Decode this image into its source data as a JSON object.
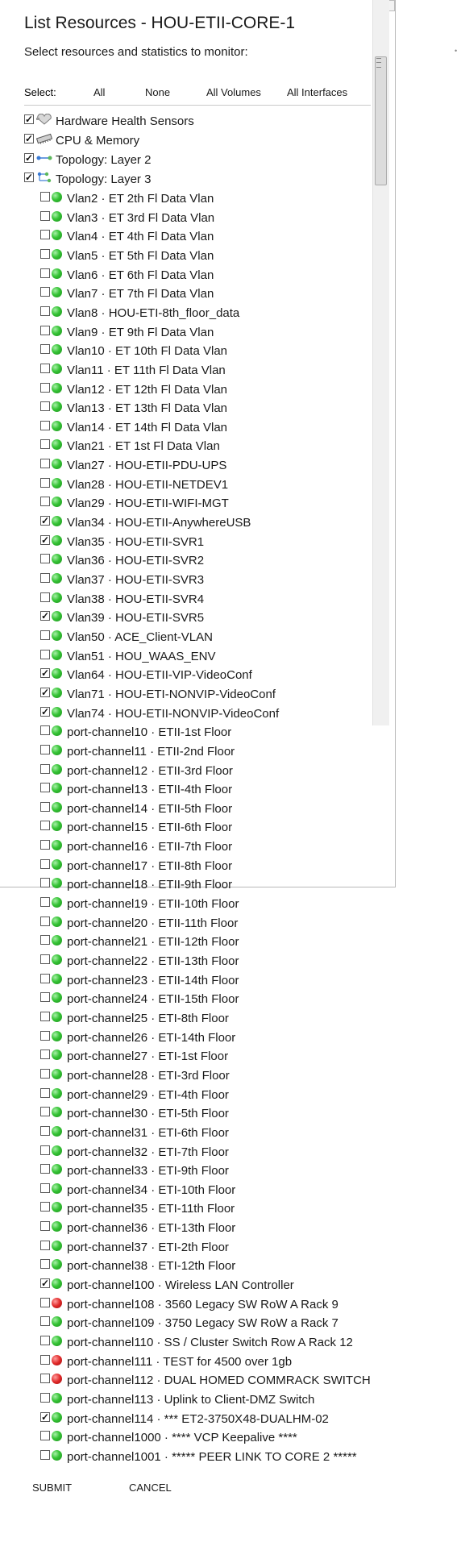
{
  "dialog": {
    "title": "List Resources - HOU-ETII-CORE-1",
    "instructions": "Select resources and statistics to monitor:"
  },
  "select_bar": {
    "label": "Select:",
    "all": "All",
    "none": "None",
    "all_volumes": "All Volumes",
    "all_interfaces": "All Interfaces"
  },
  "categories": [
    {
      "label": "Hardware Health Sensors",
      "checked": true,
      "icon": "heart-sensor-icon"
    },
    {
      "label": "CPU & Memory",
      "checked": true,
      "icon": "memory-chip-icon"
    },
    {
      "label": "Topology: Layer 2",
      "checked": true,
      "icon": "topology-l2-icon"
    },
    {
      "label": "Topology: Layer 3",
      "checked": true,
      "icon": "topology-l3-icon"
    }
  ],
  "interfaces": [
    {
      "label": "Vlan2 · ET 2th Fl Data Vlan",
      "checked": false,
      "status": "up"
    },
    {
      "label": "Vlan3 · ET 3rd Fl Data Vlan",
      "checked": false,
      "status": "up"
    },
    {
      "label": "Vlan4 · ET 4th Fl Data Vlan",
      "checked": false,
      "status": "up"
    },
    {
      "label": "Vlan5 · ET 5th Fl Data Vlan",
      "checked": false,
      "status": "up"
    },
    {
      "label": "Vlan6 · ET 6th Fl Data Vlan",
      "checked": false,
      "status": "up"
    },
    {
      "label": "Vlan7 · ET 7th Fl Data Vlan",
      "checked": false,
      "status": "up"
    },
    {
      "label": "Vlan8 · HOU-ETI-8th_floor_data",
      "checked": false,
      "status": "up"
    },
    {
      "label": "Vlan9 · ET 9th Fl Data Vlan",
      "checked": false,
      "status": "up"
    },
    {
      "label": "Vlan10 · ET 10th Fl Data Vlan",
      "checked": false,
      "status": "up"
    },
    {
      "label": "Vlan11 · ET 11th Fl Data Vlan",
      "checked": false,
      "status": "up"
    },
    {
      "label": "Vlan12 · ET 12th Fl Data Vlan",
      "checked": false,
      "status": "up"
    },
    {
      "label": "Vlan13 · ET 13th Fl Data Vlan",
      "checked": false,
      "status": "up"
    },
    {
      "label": "Vlan14 · ET 14th Fl Data Vlan",
      "checked": false,
      "status": "up"
    },
    {
      "label": "Vlan21 · ET 1st Fl Data Vlan",
      "checked": false,
      "status": "up"
    },
    {
      "label": "Vlan27 · HOU-ETII-PDU-UPS",
      "checked": false,
      "status": "up"
    },
    {
      "label": "Vlan28 · HOU-ETII-NETDEV1",
      "checked": false,
      "status": "up"
    },
    {
      "label": "Vlan29 · HOU-ETII-WIFI-MGT",
      "checked": false,
      "status": "up"
    },
    {
      "label": "Vlan34 · HOU-ETII-AnywhereUSB",
      "checked": true,
      "status": "up"
    },
    {
      "label": "Vlan35 · HOU-ETII-SVR1",
      "checked": true,
      "status": "up"
    },
    {
      "label": "Vlan36 · HOU-ETII-SVR2",
      "checked": false,
      "status": "up"
    },
    {
      "label": "Vlan37 · HOU-ETII-SVR3",
      "checked": false,
      "status": "up"
    },
    {
      "label": "Vlan38 · HOU-ETII-SVR4",
      "checked": false,
      "status": "up"
    },
    {
      "label": "Vlan39 · HOU-ETII-SVR5",
      "checked": true,
      "status": "up"
    },
    {
      "label": "Vlan50 · ACE_Client-VLAN",
      "checked": false,
      "status": "up"
    },
    {
      "label": "Vlan51 · HOU_WAAS_ENV",
      "checked": false,
      "status": "up"
    },
    {
      "label": "Vlan64 · HOU-ETII-VIP-VideoConf",
      "checked": true,
      "status": "up"
    },
    {
      "label": "Vlan71 · HOU-ETI-NONVIP-VideoConf",
      "checked": true,
      "status": "up"
    },
    {
      "label": "Vlan74 · HOU-ETII-NONVIP-VideoConf",
      "checked": true,
      "status": "up"
    },
    {
      "label": "port-channel10 · ETII-1st Floor",
      "checked": false,
      "status": "up"
    },
    {
      "label": "port-channel11 · ETII-2nd Floor",
      "checked": false,
      "status": "up"
    },
    {
      "label": "port-channel12 · ETII-3rd Floor",
      "checked": false,
      "status": "up"
    },
    {
      "label": "port-channel13 · ETII-4th Floor",
      "checked": false,
      "status": "up"
    },
    {
      "label": "port-channel14 · ETII-5th Floor",
      "checked": false,
      "status": "up"
    },
    {
      "label": "port-channel15 · ETII-6th Floor",
      "checked": false,
      "status": "up"
    },
    {
      "label": "port-channel16 · ETII-7th Floor",
      "checked": false,
      "status": "up"
    },
    {
      "label": "port-channel17 · ETII-8th Floor",
      "checked": false,
      "status": "up"
    },
    {
      "label": "port-channel18 · ETII-9th Floor",
      "checked": false,
      "status": "up"
    },
    {
      "label": "port-channel19 · ETII-10th Floor",
      "checked": false,
      "status": "up"
    },
    {
      "label": "port-channel20 · ETII-11th Floor",
      "checked": false,
      "status": "up"
    },
    {
      "label": "port-channel21 · ETII-12th Floor",
      "checked": false,
      "status": "up"
    },
    {
      "label": "port-channel22 · ETII-13th Floor",
      "checked": false,
      "status": "up"
    },
    {
      "label": "port-channel23 · ETII-14th Floor",
      "checked": false,
      "status": "up"
    },
    {
      "label": "port-channel24 · ETII-15th Floor",
      "checked": false,
      "status": "up"
    },
    {
      "label": "port-channel25 · ETI-8th Floor",
      "checked": false,
      "status": "up"
    },
    {
      "label": "port-channel26 · ETI-14th Floor",
      "checked": false,
      "status": "up"
    },
    {
      "label": "port-channel27 · ETI-1st Floor",
      "checked": false,
      "status": "up"
    },
    {
      "label": "port-channel28 · ETI-3rd Floor",
      "checked": false,
      "status": "up"
    },
    {
      "label": "port-channel29 · ETI-4th Floor",
      "checked": false,
      "status": "up"
    },
    {
      "label": "port-channel30 · ETI-5th Floor",
      "checked": false,
      "status": "up"
    },
    {
      "label": "port-channel31 · ETI-6th Floor",
      "checked": false,
      "status": "up"
    },
    {
      "label": "port-channel32 · ETI-7th Floor",
      "checked": false,
      "status": "up"
    },
    {
      "label": "port-channel33 · ETI-9th Floor",
      "checked": false,
      "status": "up"
    },
    {
      "label": "port-channel34 · ETI-10th Floor",
      "checked": false,
      "status": "up"
    },
    {
      "label": "port-channel35 · ETI-11th Floor",
      "checked": false,
      "status": "up"
    },
    {
      "label": "port-channel36 · ETI-13th Floor",
      "checked": false,
      "status": "up"
    },
    {
      "label": "port-channel37 · ETI-2th Floor",
      "checked": false,
      "status": "up"
    },
    {
      "label": "port-channel38 · ETI-12th Floor",
      "checked": false,
      "status": "up"
    },
    {
      "label": "port-channel100 · Wireless LAN Controller",
      "checked": true,
      "status": "up"
    },
    {
      "label": "port-channel108 · 3560 Legacy SW RoW A Rack 9",
      "checked": false,
      "status": "down"
    },
    {
      "label": "port-channel109 · 3750 Legacy SW RoW a Rack 7",
      "checked": false,
      "status": "up"
    },
    {
      "label": "port-channel110 · SS / Cluster Switch Row A Rack 12",
      "checked": false,
      "status": "up"
    },
    {
      "label": "port-channel111 · TEST for 4500 over 1gb",
      "checked": false,
      "status": "down"
    },
    {
      "label": "port-channel112 · DUAL HOMED COMMRACK SWITCH",
      "checked": false,
      "status": "down"
    },
    {
      "label": "port-channel113 · Uplink to Client-DMZ Switch",
      "checked": false,
      "status": "up"
    },
    {
      "label": "port-channel114 · *** ET2-3750X48-DUALHM-02",
      "checked": true,
      "status": "up"
    },
    {
      "label": "port-channel1000 · **** VCP Keepalive ****",
      "checked": false,
      "status": "up"
    },
    {
      "label": "port-channel1001 · ***** PEER LINK TO CORE 2 *****",
      "checked": false,
      "status": "up"
    }
  ],
  "buttons": {
    "submit": "SUBMIT",
    "cancel": "CANCEL"
  },
  "colors": {
    "status_up": "#2fbf2f",
    "status_down": "#d92323"
  }
}
